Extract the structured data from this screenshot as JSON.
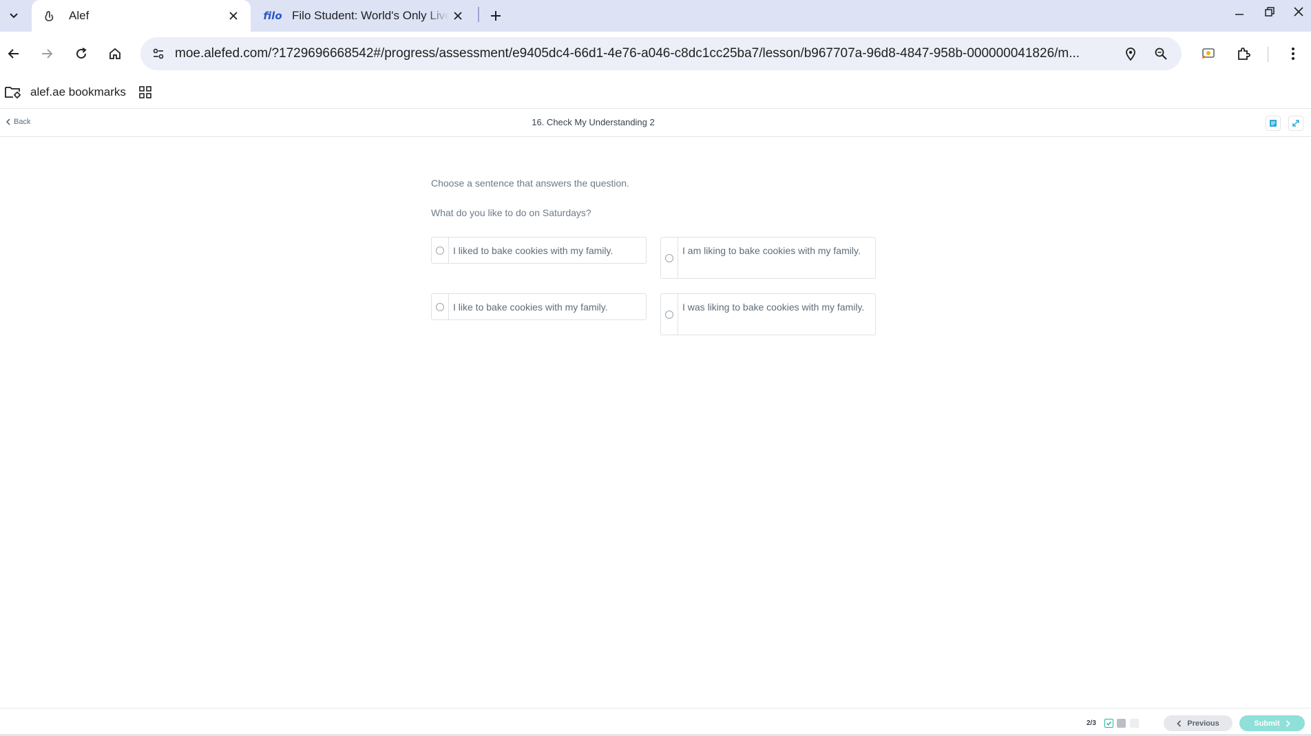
{
  "browser": {
    "tabs": [
      {
        "title": "Alef",
        "favicon": "alef-logo-icon",
        "active": true
      },
      {
        "title": "Filo Student: World's Only Live I",
        "favicon_text": "filo",
        "active": false
      }
    ],
    "url": "moe.alefed.com/?1729696668542#/progress/assessment/e9405dc4-66d1-4e76-a046-c8dc1cc25ba7/lesson/b967707a-96d8-4847-958b-000000041826/m...",
    "bookmarks": {
      "folder_label": "alef.ae bookmarks"
    }
  },
  "page": {
    "back_label": "Back",
    "lesson_title": "16. Check My Understanding 2"
  },
  "question": {
    "instruction": "Choose a sentence that answers the question.",
    "prompt": "What do you like to do on Saturdays?",
    "options": [
      {
        "text": "I liked to bake cookies with my family."
      },
      {
        "text": "I am liking to bake cookies with my family."
      },
      {
        "text": "I like to bake cookies with my family."
      },
      {
        "text": "I was liking to bake cookies with my family."
      }
    ]
  },
  "footer": {
    "page_count": "2/3",
    "previous_label": "Previous",
    "submit_label": "Submit"
  },
  "colors": {
    "accent": "#21b3a5",
    "submit_bg": "#8ee0d8",
    "tab_strip": "#dde3f5",
    "question_text": "#6d7b87"
  }
}
